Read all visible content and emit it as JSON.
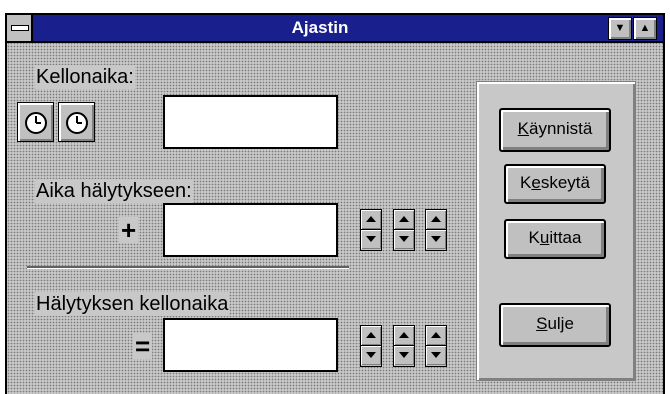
{
  "window": {
    "title": "Ajastin",
    "minimize_glyph": "▼",
    "maximize_glyph": "▲"
  },
  "kellonaika": {
    "label": "Kellonaika:",
    "value": "",
    "buttons": [
      "clock-icon",
      "clock-icon"
    ]
  },
  "aika_halytykseen": {
    "label": "Aika hälytykseen:",
    "operator": "+",
    "value": "",
    "spinners": 3
  },
  "halytyksen_kellonaika": {
    "label": "Hälytyksen kellonaika",
    "operator": "=",
    "value": "",
    "spinners": 3
  },
  "buttons": {
    "kaynnista": {
      "mnemonic": "K",
      "rest": "äynnistä"
    },
    "keskeyta": {
      "pre": "K",
      "mnemonic": "e",
      "rest": "skeytä"
    },
    "kuittaa": {
      "pre": "K",
      "mnemonic": "u",
      "rest": "ittaa"
    },
    "sulje": {
      "mnemonic": "S",
      "rest": "ulje"
    }
  }
}
